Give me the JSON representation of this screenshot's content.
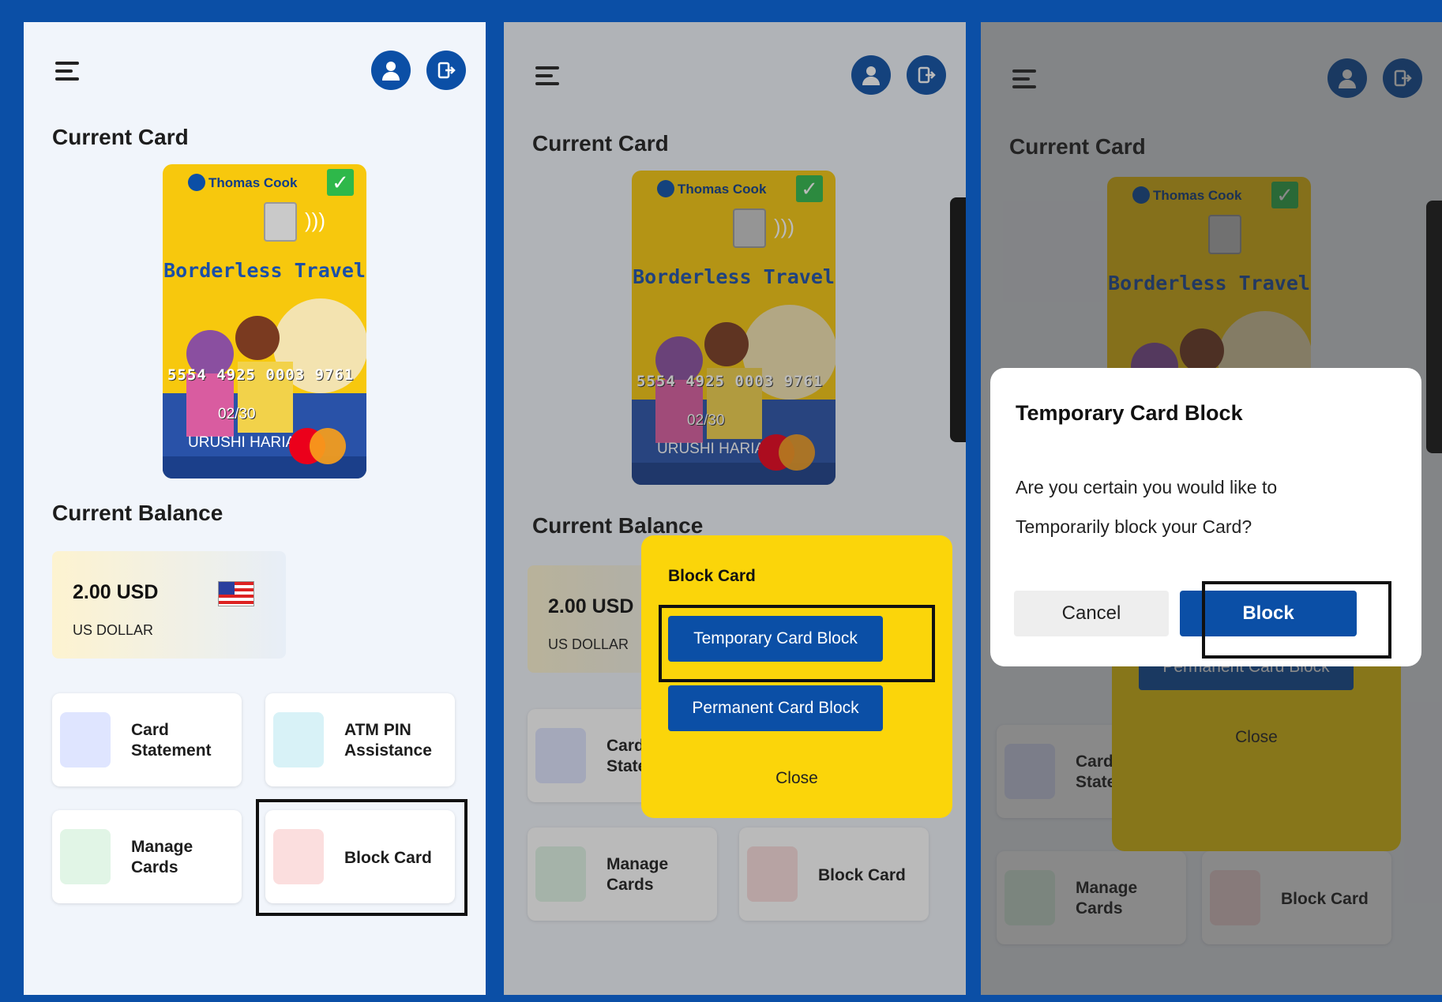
{
  "header": {
    "menu_icon": "hamburger-icon",
    "profile_icon": "user-icon",
    "logout_icon": "logout-icon"
  },
  "sections": {
    "current_card": "Current Card",
    "current_balance": "Current Balance"
  },
  "card": {
    "brand": "Thomas Cook",
    "tagline": "Borderless Travel",
    "number": "5554 4925 0003 9761",
    "expiry": "02/30",
    "holder": "URUSHI HARIA"
  },
  "balance": {
    "amount": "2.00 USD",
    "currency": "US DOLLAR"
  },
  "tiles": {
    "statement": "Card Statement",
    "atm_pin": "ATM PIN Assistance",
    "manage": "Manage Cards",
    "block": "Block Card"
  },
  "block_popover": {
    "title": "Block Card",
    "temporary": "Temporary Card Block",
    "permanent": "Permanent Card Block",
    "close": "Close"
  },
  "confirm_dialog": {
    "title": "Temporary Card Block",
    "message": "Are you certain you would like to Temporarily block your Card?",
    "cancel": "Cancel",
    "confirm": "Block"
  },
  "colors": {
    "primary": "#0b4fa6",
    "card_yellow": "#f7c80d",
    "popover_yellow": "#fbd50a",
    "check_green": "#2eb84a"
  }
}
